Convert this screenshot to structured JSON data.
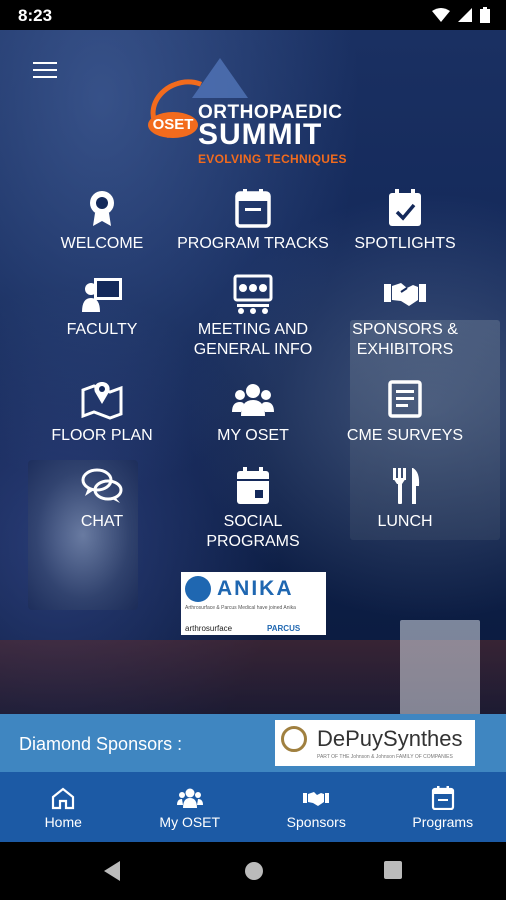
{
  "status_bar": {
    "time": "8:23"
  },
  "logo": {
    "badge": "OSET",
    "line1": "ORTHOPAEDIC",
    "line2": "SUMMIT",
    "tagline": "EVOLVING TECHNIQUES"
  },
  "menu": {
    "welcome": "WELCOME",
    "program_tracks": "PROGRAM TRACKS",
    "spotlights": "SPOTLIGHTS",
    "faculty": "FACULTY",
    "meeting_info": "MEETING AND\nGENERAL INFO",
    "sponsors_exhibitors": "SPONSORS &\nEXHIBITORS",
    "floor_plan": "FLOOR PLAN",
    "my_oset": "MY OSET",
    "cme_surveys": "CME SURVEYS",
    "chat": "CHAT",
    "social_programs": "SOCIAL\nPROGRAMS",
    "lunch": "LUNCH"
  },
  "ad_banner": {
    "name": "ANIKA",
    "small_text": "Arthrosurface & Parcus Medical have joined Anika",
    "brand1": "arthrosurface",
    "brand2": "PARCUS"
  },
  "sponsor_bar": {
    "label": "Diamond Sponsors :",
    "sponsor_name": "DePuySynthes",
    "sponsor_tagline": "PART OF THE Johnson & Johnson FAMILY OF COMPANIES"
  },
  "tabs": {
    "home": "Home",
    "my_oset": "My OSET",
    "sponsors": "Sponsors",
    "programs": "Programs"
  },
  "colors": {
    "accent_orange": "#f26b1d",
    "tab_blue": "#1c5aa5",
    "sponsor_blue": "#3f86c1"
  }
}
